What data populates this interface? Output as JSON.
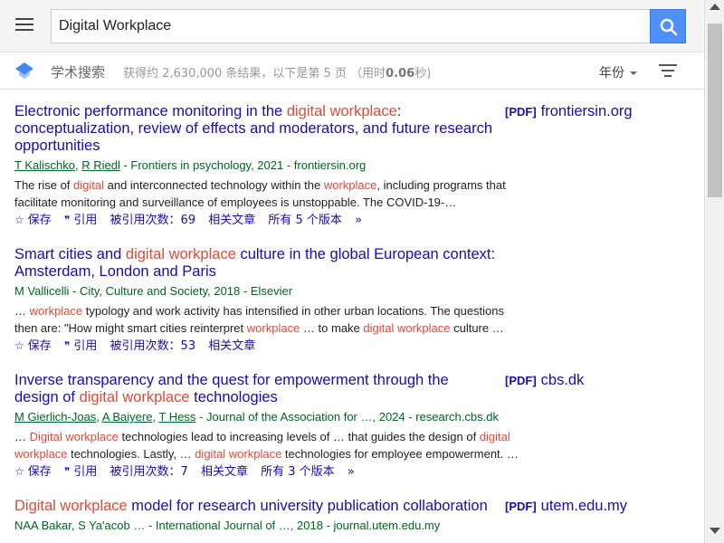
{
  "header": {
    "search_value": "Digital Workplace"
  },
  "subheader": {
    "scholar_title": "学术搜索",
    "stats_prefix": "获得约 2,630,000 条结果，以下是第 5 页 （用时",
    "stats_time": "0.06",
    "stats_suffix": "秒)",
    "year_label": "年份"
  },
  "actions": {
    "save": "保存",
    "cite": "引用",
    "related": "相关文章"
  },
  "results": [
    {
      "title_parts": [
        "Electronic performance monitoring in the ",
        "digital workplace",
        ": conceptualization, review of effects and moderators, and future research opportunities"
      ],
      "pdf_tag": "[PDF]",
      "pdf_domain": "frontiersin.org",
      "authors": [
        "T Kalischko",
        "R Riedl"
      ],
      "source": " - Frontiers in psychology, 2021 - frontiersin.org",
      "snippet_parts": [
        "The rise of ",
        "digital",
        " and interconnected technology within the ",
        "workplace",
        ", including programs that facilitate monitoring and surveillance of employees is unstoppable. The COVID-19-…"
      ],
      "cited_by": "被引用次数：69",
      "versions": "所有 5 个版本"
    },
    {
      "title_parts": [
        "Smart cities and ",
        "digital workplace",
        " culture in the global European context: Amsterdam, London and Paris"
      ],
      "authors_plain": "M Vallicelli - City, Culture and Society, 2018 - Elsevier",
      "snippet_parts": [
        "… ",
        "workplace",
        " typology and work activity has intensified in other urban locations. The questions then are: \"How might smart cities reinterpret ",
        "workplace",
        " … to make ",
        "digital workplace",
        " culture …"
      ],
      "cited_by": "被引用次数：53"
    },
    {
      "title_parts": [
        "Inverse transparency and the quest for empowerment through the design of ",
        "digital workplace",
        " technologies"
      ],
      "pdf_tag": "[PDF]",
      "pdf_domain": "cbs.dk",
      "authors": [
        "M Gierlich-Joas",
        "A Baiyere",
        "T Hess"
      ],
      "source": " - Journal of the Association for …, 2024 - research.cbs.dk",
      "snippet_parts": [
        "… ",
        "Digital workplace",
        " technologies lead to increasing levels of … that guides the design of ",
        "digital workplace",
        " technologies. Lastly, … ",
        "digital workplace",
        " technologies for employee empowerment. …"
      ],
      "cited_by": "被引用次数：7",
      "versions": "所有 3 个版本"
    },
    {
      "title_parts": [
        "Digital workplace",
        " model for research university publication collaboration"
      ],
      "pdf_tag": "[PDF]",
      "pdf_domain": "utem.edu.my",
      "authors_plain": "NAA Bakar, S Ya'acob … - International Journal of …, 2018 - journal.utem.edu.my"
    }
  ]
}
